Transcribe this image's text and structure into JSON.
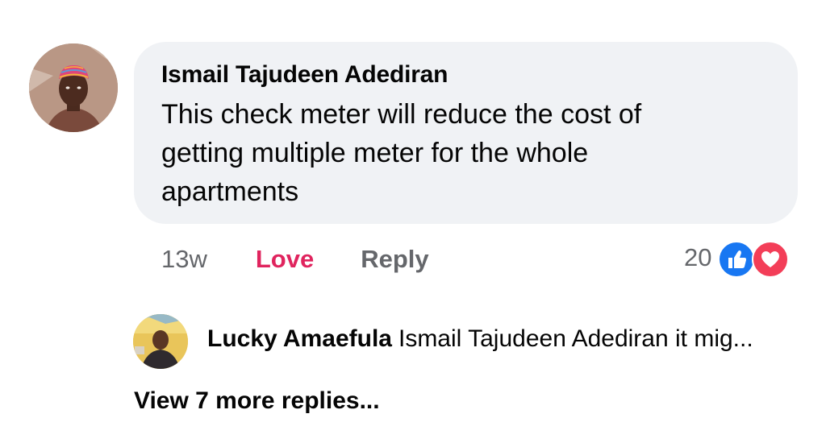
{
  "comment": {
    "author": "Ismail Tajudeen Adediran",
    "text": "This check meter will reduce the cost of getting multiple meter for the whole apartments",
    "time": "13w",
    "love_label": "Love",
    "reply_label": "Reply",
    "reaction_count": "20",
    "reaction_icons": [
      "like-icon",
      "love-icon"
    ],
    "colors": {
      "love": "#e0245e",
      "like": "#1877f2",
      "heart": "#f33e58",
      "bubble": "#f0f2f5"
    }
  },
  "reply_preview": {
    "author": "Lucky Amaefula",
    "snippet": "Ismail Tajudeen Adediran it mig..."
  },
  "view_more": {
    "label": "View 7 more replies..."
  }
}
